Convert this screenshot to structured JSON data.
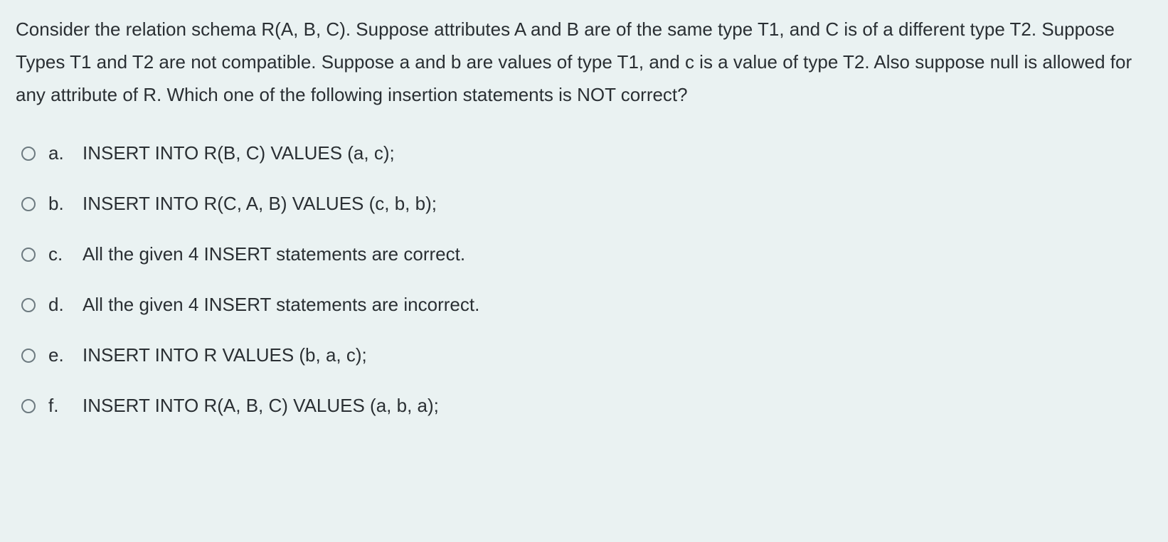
{
  "question": {
    "text": "Consider the relation schema R(A, B, C). Suppose attributes A and B are of the same type T1, and C is of a different type T2. Suppose Types T1 and T2 are not compatible. Suppose a and b are values of type T1, and c is a value of type T2. Also suppose null is allowed for any attribute of R. Which one of the following insertion statements is NOT correct?"
  },
  "options": [
    {
      "letter": "a.",
      "text": "INSERT INTO R(B, C) VALUES (a, c);"
    },
    {
      "letter": "b.",
      "text": "INSERT INTO R(C, A, B) VALUES (c, b, b);"
    },
    {
      "letter": "c.",
      "text": "All the given 4 INSERT statements are correct."
    },
    {
      "letter": "d.",
      "text": "All the given 4 INSERT statements are incorrect."
    },
    {
      "letter": "e.",
      "text": "INSERT INTO R VALUES (b, a, c);"
    },
    {
      "letter": "f.",
      "text": "INSERT INTO R(A, B, C) VALUES (a, b, a);"
    }
  ]
}
